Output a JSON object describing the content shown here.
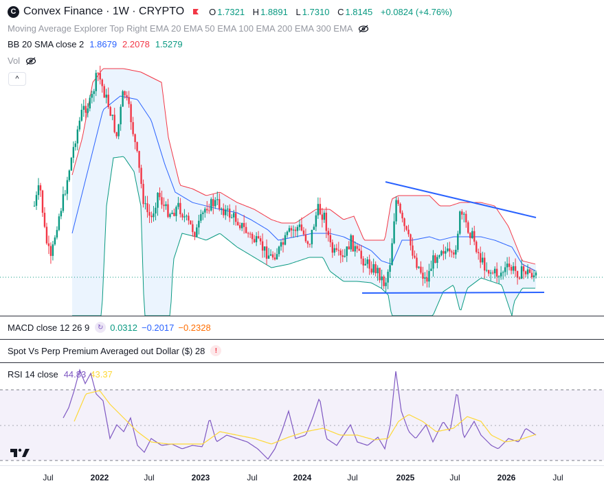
{
  "header": {
    "symbol_icon": "C",
    "title": "Convex Finance · 1W · CRYPTO",
    "ohlc": {
      "o_label": "O",
      "o": "1.7321",
      "h_label": "H",
      "h": "1.8891",
      "l_label": "L",
      "l": "1.7310",
      "c_label": "C",
      "c": "1.8145",
      "change": "+0.0824 (+4.76%)"
    },
    "ma_legend": "Moving Average Explorer Top Right EMA 20 EMA 50 EMA 100 EMA 200 EMA 300 EMA",
    "bb": {
      "label": "BB 20 SMA close 2",
      "basis": "1.8679",
      "upper": "2.2078",
      "lower": "1.5279"
    },
    "vol_label": "Vol",
    "collapse_glyph": "^"
  },
  "panes": {
    "macd": {
      "label": "MACD close 12 26 9",
      "v1": "0.0312",
      "v2": "−0.2017",
      "v3": "−0.2328"
    },
    "spot_perp": {
      "label": "Spot Vs Perp Premium Averaged out Dollar ($) 28"
    },
    "rsi": {
      "label": "RSI 14 close",
      "v1": "44.83",
      "v2": "43.37"
    }
  },
  "x_axis": [
    {
      "label": "Jul",
      "bold": false
    },
    {
      "label": "2022",
      "bold": true
    },
    {
      "label": "Jul",
      "bold": false
    },
    {
      "label": "2023",
      "bold": true
    },
    {
      "label": "Jul",
      "bold": false
    },
    {
      "label": "2024",
      "bold": true
    },
    {
      "label": "Jul",
      "bold": false
    },
    {
      "label": "2025",
      "bold": true
    },
    {
      "label": "Jul",
      "bold": false
    },
    {
      "label": "2026",
      "bold": true
    },
    {
      "label": "Jul",
      "bold": false
    }
  ],
  "colors": {
    "up": "#089981",
    "down": "#f23645",
    "bb_upper": "#f23645",
    "bb_basis": "#2962ff",
    "bb_lower": "#089981",
    "bb_fill": "#e3effd",
    "trendline": "#2962ff",
    "rsi": "#7e57c2",
    "rsi_ma": "#fdd835",
    "rsi_band": "#ede7f6"
  },
  "logo": "TradingView"
}
